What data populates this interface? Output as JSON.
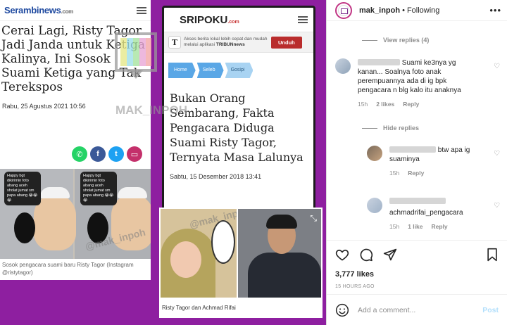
{
  "post": {
    "left_card": {
      "source_logo": "Serambinews",
      "source_logo_suffix": ".com",
      "headline": "Cerai Lagi, Risty Tagor Jadi Janda untuk Ketiga Kalinya, Ini Sosok Suami Ketiga yang Tak Terekspos",
      "date": "Rabu, 25 Agustus 2021 10:56",
      "share_buttons": [
        "whatsapp-icon",
        "facebook-icon",
        "twitter-icon",
        "comment-icon"
      ],
      "photo_bubble": "Happy bgt dikirimin foto abang aceh sholat jumat sm papa abang 😭😭😭",
      "photo_watermark": "@mak_inpoh",
      "caption": "Sosok pengacara suami baru Risty Tagor (Instagram @ristytagor)"
    },
    "watermark_text": "MAK_INPOH",
    "mid_card": {
      "source_logo": "SRIPOKU",
      "source_logo_suffix": ".com",
      "promo_icon_letter": "T",
      "promo_text": "Akses berita lokal lebih cepat dan mudah melalui aplikasi",
      "promo_brand": "TRIBUNnews",
      "promo_button": "Unduh",
      "breadcrumbs": [
        "Home",
        "Seleb",
        "Gosipi"
      ],
      "headline": "Bukan Orang Sembarang, Fakta Pengacara Diduga Suami Risty Tagor, Ternyata Masa Lalunya",
      "date": "Sabtu, 15 Desember 2018 13:41"
    },
    "photo_card": {
      "watermark": "@mak_inpoh",
      "caption": "Risty Tagor dan Achmad Rifai"
    }
  },
  "instagram": {
    "username": "mak_inpoh",
    "follow_status": "Following",
    "view_replies": "View replies (4)",
    "hide_replies": "Hide replies",
    "comments": [
      {
        "text": "Suami ke3nya yg kanan... Soalnya foto anak perempuannya ada di ig bpk pengacara n blg kalo itu anaknya",
        "time": "15h",
        "likes": "2 likes",
        "reply": "Reply"
      },
      {
        "text": "btw apa ig suaminya",
        "time": "15h",
        "reply": "Reply"
      },
      {
        "text": "achmadrifai_pengacara",
        "time": "15h",
        "likes": "1 like",
        "reply": "Reply"
      }
    ],
    "likes": "3,777 likes",
    "timestamp": "15 HOURS AGO",
    "add_comment_placeholder": "Add a comment...",
    "post_label": "Post",
    "colors": {
      "background_purple": "#8e1fa0",
      "post_button": "#b2dffc",
      "muted_text": "#8e8e8e"
    }
  }
}
